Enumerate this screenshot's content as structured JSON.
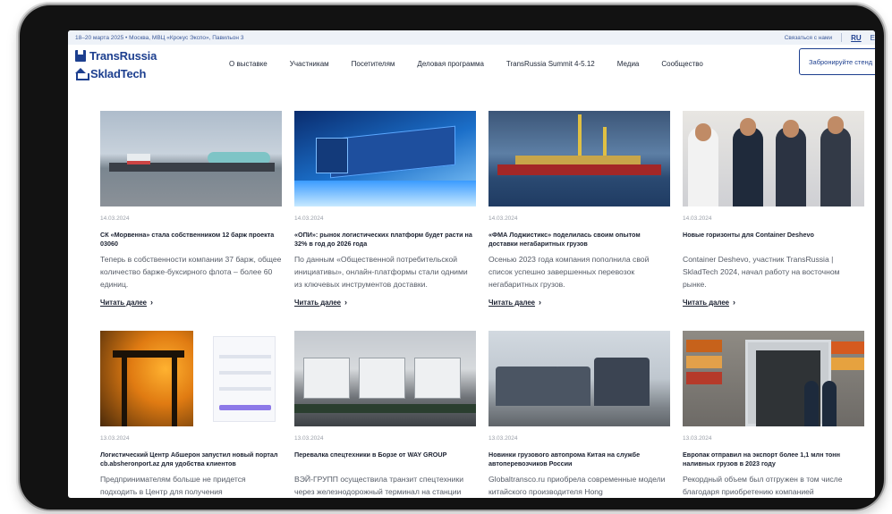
{
  "topbar": {
    "event_info": "18–20 марта 2025 • Москва, МВЦ «Крокус Экспо», Павильон 3",
    "contact_link": "Связаться с нами",
    "lang_active": "RU",
    "lang_other": "E"
  },
  "header": {
    "logo_transrussia": "TransRussia",
    "logo_skladtech": "SkladTech",
    "nav": [
      "О выставке",
      "Участникам",
      "Посетителям",
      "Деловая программа",
      "TransRussia Summit 4-5.12",
      "Медиа",
      "Сообщество"
    ],
    "book_button": "Забронируйте стенд"
  },
  "read_more_label": "Читать далее",
  "articles": [
    {
      "date": "14.03.2024",
      "title": "СК «Морвенна» стала собственником 12 барж проекта 03060",
      "excerpt": "Теперь в собственности компании 37 барж, общее количество баржe-буксирного флота – более 60 единиц.",
      "image": "barge-river-photo"
    },
    {
      "date": "14.03.2024",
      "title": "«ОПИ»: рынок логистических платформ будет расти на 32% в год до 2026 года",
      "excerpt": "По данным «Общественной потребительской инициативы», онлайн-платформы стали одними из ключевых инструментов доставки.",
      "image": "digital-truck-illustration"
    },
    {
      "date": "14.03.2024",
      "title": "«ФМА Лоджистикс» поделилась своим опытом доставки негабаритных грузов",
      "excerpt": "Осенью 2023 года компания пополнила свой список успешно завершенных перевозок негабаритных грузов.",
      "image": "cargo-ship-photo"
    },
    {
      "date": "14.03.2024",
      "title": "Новые горизонты для Container Deshevo",
      "excerpt": "Container Deshevo, участник TransRussia | SkladTech 2024, начал работу на восточном рынке.",
      "image": "people-at-expo-photo"
    },
    {
      "date": "13.03.2024",
      "title": "Логистический Центр Абшерон запустил новый портал cb.absheronport.az для удобства клиентов",
      "excerpt": "Предпринимателям больше не придется подходить в Центр для получения",
      "image": "port-crane-and-portal-screenshot"
    },
    {
      "date": "13.03.2024",
      "title": "Перевалка спецтехники в Борзе от WAY GROUP",
      "excerpt": "ВЭЙ-ГРУПП осуществила транзит спецтехники через железнодорожный терминал на станции Борзя в Забайкальско",
      "image": "railway-special-equipment-photo"
    },
    {
      "date": "13.03.2024",
      "title": "Новинки грузового автопрома Китая на службе автоперевозчиков России",
      "excerpt": "Globaltransco.ru приобрела современные модели китайского производителя Hong",
      "image": "trucks-parking-photo"
    },
    {
      "date": "13.03.2024",
      "title": "Европак отправил на экспорт более 1,1 млн тонн наливных грузов в 2023 году",
      "excerpt": "Рекордный объем был отгружен в том числе благодаря приобретению компанией",
      "image": "container-loading-photo"
    }
  ]
}
